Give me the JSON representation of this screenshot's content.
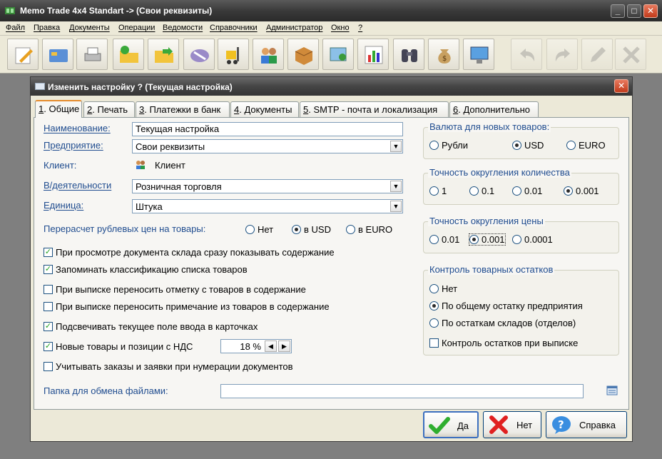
{
  "app": {
    "title": "Memo Trade 4x4 Standart -> (Свои реквизиты)",
    "controls": {
      "minimize": "_",
      "maximize": "□",
      "close": "✕"
    }
  },
  "menu": [
    "Файл",
    "Правка",
    "Документы",
    "Операции",
    "Ведомости",
    "Справочники",
    "Администратор",
    "Окно",
    "?"
  ],
  "toolbar": {
    "icons": [
      "edit-icon",
      "card-icon",
      "printer-icon",
      "folder-add-icon",
      "folder-export-icon",
      "disk-icon",
      "forklift-icon",
      "users-icon",
      "box-icon",
      "map-user-icon",
      "chart-icon",
      "binoculars-icon",
      "money-bag-icon",
      "monitor-icon",
      "undo-icon",
      "redo-icon",
      "pencil-icon",
      "delete-icon"
    ]
  },
  "dialog": {
    "title": "Изменить настройку ? (Текущая настройка)",
    "close": "✕",
    "tabs": [
      {
        "key": "1",
        "label": ". Общие"
      },
      {
        "key": "2",
        "label": ". Печать"
      },
      {
        "key": "3",
        "label": ". Платежки в банк"
      },
      {
        "key": "4",
        "label": ". Документы"
      },
      {
        "key": "5",
        "label": ". SMTP - почта и локализация"
      },
      {
        "key": "6",
        "label": ". Дополнительно"
      }
    ],
    "fields": {
      "name_label": "Наименование:",
      "name_value": "Текущая настройка",
      "company_label": "Предприятие:",
      "company_value": "Свои реквизиты",
      "client_label": "Клиент:",
      "client_value": "Клиент",
      "activity_label": "В/деятельности",
      "activity_value": "Розничная торговля",
      "unit_label": "Единица:",
      "unit_value": "Штука"
    },
    "recalc": {
      "label": "Перерасчет рублевых цен на товары:",
      "options": [
        "Нет",
        "в USD",
        "в EURO"
      ],
      "selected": 1
    },
    "checks": [
      {
        "label": "При просмотре документа склада сразу показывать содержание",
        "checked": true
      },
      {
        "label": "Запоминать классификацию списка товаров",
        "checked": true
      },
      {
        "label": "При выписке переносить отметку с товаров в содержание",
        "checked": false
      },
      {
        "label": "При выписке переносить примечание из товаров в содержание",
        "checked": false
      },
      {
        "label": "Подсвечивать текущее поле ввода в карточках",
        "checked": true
      },
      {
        "label": "Новые товары и позиции с НДС",
        "checked": true
      },
      {
        "label": "Учитывать заказы и заявки при нумерации документов",
        "checked": false
      }
    ],
    "vat_value": "18 %",
    "folder_label": "Папка для обмена файлами:",
    "folder_value": "",
    "currency": {
      "title": "Валюта для новых товаров:",
      "options": [
        "Рубли",
        "USD",
        "EURO"
      ],
      "selected": 1
    },
    "qty_precision": {
      "title": "Точность округления количества",
      "options": [
        "1",
        "0.1",
        "0.01",
        "0.001"
      ],
      "selected": 3
    },
    "price_precision": {
      "title": "Точность округления цены",
      "options": [
        "0.01",
        "0.001",
        "0.0001"
      ],
      "selected": 1
    },
    "stock_control": {
      "title": "Контроль товарных остатков",
      "options": [
        "Нет",
        "По общему остатку предприятия",
        "По остаткам складов (отделов)"
      ],
      "selected": 1,
      "check_label": "Контроль остатков при выписке",
      "check_checked": false
    },
    "buttons": {
      "ok": "Да",
      "cancel": "Нет",
      "help": "Справка"
    }
  },
  "colors": {
    "accent_tab": "#e68b2c",
    "group_title": "#1f4c8f"
  }
}
